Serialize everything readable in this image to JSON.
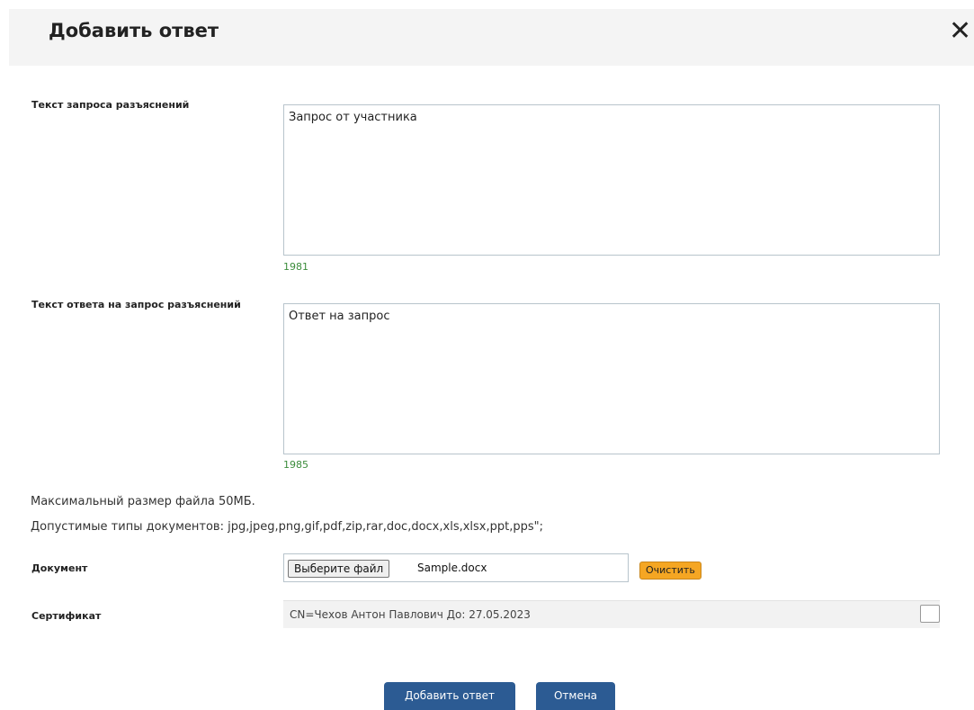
{
  "dialog": {
    "title": "Добавить ответ",
    "close_glyph": "✕"
  },
  "request": {
    "label": "Текст запроса разъяснений",
    "value": "Запрос от участника",
    "counter": "1981"
  },
  "answer": {
    "label": "Текст ответа на запрос разъяснений",
    "value": "Ответ на запрос",
    "counter": "1985"
  },
  "info": {
    "max_size": "Максимальный размер файла 50МБ.",
    "allowed_types": "Допустимые типы документов: jpg,jpeg,png,gif,pdf,zip,rar,doc,docx,xls,xlsx,ppt,pps\";"
  },
  "document": {
    "label": "Документ",
    "choose_button": "Выберите файл",
    "file_name": "Sample.docx",
    "clear_button": "Очистить"
  },
  "certificate": {
    "label": "Сертификат",
    "value": "CN=Чехов Антон Павлович До: 27.05.2023"
  },
  "actions": {
    "submit": "Добавить ответ",
    "cancel": "Отмена"
  },
  "colors": {
    "primary": "#2c5b93",
    "clear_accent": "#f5a623",
    "counter_green": "#3b8c3b"
  }
}
